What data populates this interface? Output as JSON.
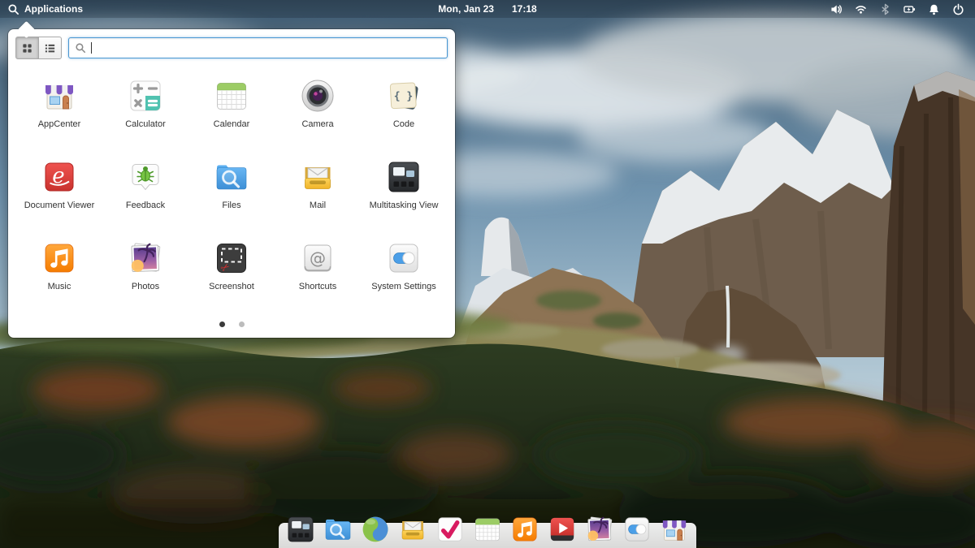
{
  "panel": {
    "applications_label": "Applications",
    "date": "Mon, Jan 23",
    "time": "17:18",
    "indicator_icons": [
      "volume-icon",
      "wifi-icon",
      "bluetooth-icon",
      "battery-charging-icon",
      "notifications-bell-icon",
      "power-icon"
    ]
  },
  "menu": {
    "view_toggle": {
      "options": [
        "grid-view",
        "list-view"
      ],
      "active": "grid-view"
    },
    "search": {
      "value": "",
      "placeholder": ""
    },
    "apps": [
      "AppCenter",
      "Calculator",
      "Calendar",
      "Camera",
      "Code",
      "Document Viewer",
      "Feedback",
      "Files",
      "Mail",
      "Multitasking View",
      "Music",
      "Photos",
      "Screenshot",
      "Shortcuts",
      "System Settings"
    ],
    "pagination": {
      "page_count": 2,
      "active_page": 1
    }
  },
  "dock": {
    "items": [
      "Multitasking View",
      "Files",
      "Web",
      "Mail",
      "Tasks",
      "Calendar",
      "Music",
      "Videos",
      "Photos",
      "System Settings",
      "AppCenter"
    ]
  },
  "colors": {
    "search_focus_border": "#4a97d2",
    "panel_text": "#ffffff",
    "menu_background": "#ffffff",
    "app_label_text": "#333333",
    "dot_active": "#3a3a3a",
    "dot_inactive": "#bcbcbc"
  }
}
